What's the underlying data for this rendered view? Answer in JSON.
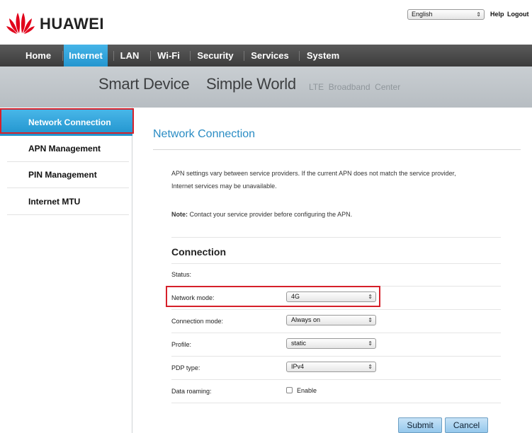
{
  "header": {
    "brand": "HUAWEI",
    "language": "English",
    "help_label": "Help",
    "logout_label": "Logout"
  },
  "nav": {
    "items": [
      {
        "label": "Home"
      },
      {
        "label": "Internet"
      },
      {
        "label": "LAN"
      },
      {
        "label": "Wi-Fi"
      },
      {
        "label": "Security"
      },
      {
        "label": "Services"
      },
      {
        "label": "System"
      }
    ],
    "active": "Internet"
  },
  "banner": {
    "slogan1": "Smart Device",
    "slogan2": "Simple World",
    "subtitle": "LTE  Broadband  Center"
  },
  "sidebar": {
    "items": [
      {
        "label": "Network Connection"
      },
      {
        "label": "APN Management"
      },
      {
        "label": "PIN Management"
      },
      {
        "label": "Internet MTU"
      }
    ],
    "active": "Network Connection"
  },
  "main": {
    "title": "Network Connection",
    "intro_line1": "APN settings vary between service providers. If the current APN does not match the service provider,",
    "intro_line2": "Internet services may be unavailable.",
    "note_label": "Note:",
    "note_text": " Contact your service provider before configuring the APN.",
    "section_title": "Connection",
    "status_label": "Status:",
    "network_mode_label": "Network mode:",
    "network_mode_value": "4G",
    "connection_mode_label": "Connection mode:",
    "connection_mode_value": "Always on",
    "profile_label": "Profile:",
    "profile_value": "static",
    "pdp_type_label": "PDP type:",
    "pdp_type_value": "IPv4",
    "data_roaming_label": "Data roaming:",
    "data_roaming_checkbox_label": "Enable",
    "data_roaming_enabled": false,
    "submit_label": "Submit",
    "cancel_label": "Cancel"
  },
  "colors": {
    "accent": "#2a9fd8",
    "highlight_box": "#d6202a",
    "brand_logo": "#e1001a",
    "nav_bg": "#4a4a4a"
  },
  "icons": {
    "logo": "huawei-petal-logo",
    "select_arrow": "updown-arrows-icon"
  }
}
